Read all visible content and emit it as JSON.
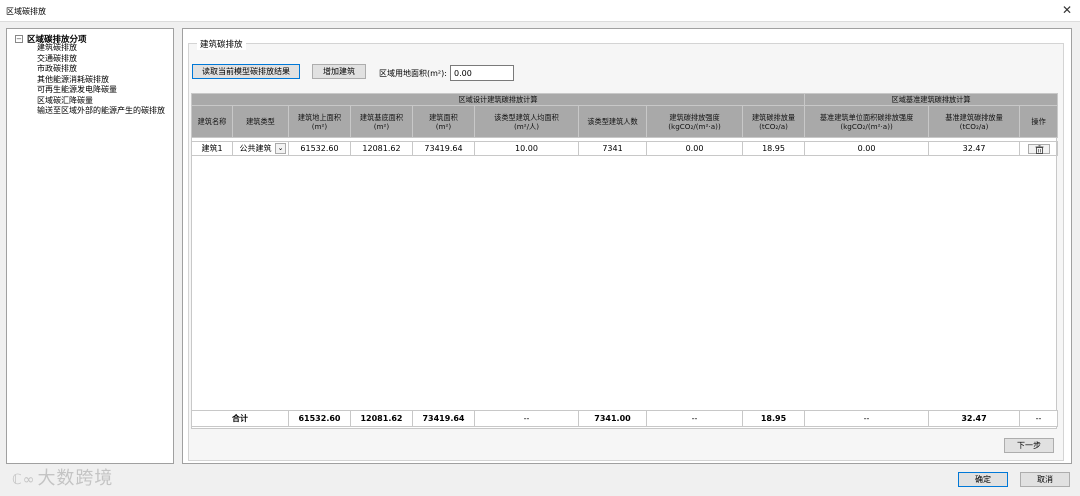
{
  "window": {
    "title": "区域碳排放",
    "close_glyph": "✕"
  },
  "tree": {
    "expander": "−",
    "root": "区域碳排放分项",
    "items": [
      "建筑碳排放",
      "交通碳排放",
      "市政碳排放",
      "其他能源消耗碳排放",
      "可再生能源发电降碳量",
      "区域碳汇降碳量",
      "输送至区域外部的能源产生的碳排放"
    ]
  },
  "panel": {
    "title": "建筑碳排放",
    "read_button": "读取当前模型碳排放结果",
    "add_button": "增加建筑",
    "area_label": "区域用地面积(m²):",
    "area_value": "0.00"
  },
  "table": {
    "group_design": "区域设计建筑碳排放计算",
    "group_baseline": "区域基准建筑碳排放计算",
    "columns": [
      [
        "建筑名称",
        ""
      ],
      [
        "建筑类型",
        ""
      ],
      [
        "建筑地上面积",
        "(m²)"
      ],
      [
        "建筑基底面积",
        "(m²)"
      ],
      [
        "建筑面积",
        "(m²)"
      ],
      [
        "该类型建筑人均面积",
        "(m²/人)"
      ],
      [
        "该类型建筑人数",
        ""
      ],
      [
        "建筑碳排放强度",
        "(kgCO₂/(m²·a))"
      ],
      [
        "建筑碳排放量",
        "(tCO₂/a)"
      ],
      [
        "基准建筑单位面积碳排放强度",
        "(kgCO₂/(m²·a))"
      ],
      [
        "基准建筑碳排放量",
        "(tCO₂/a)"
      ],
      [
        "操作",
        ""
      ]
    ],
    "rows": [
      {
        "name": "建筑1",
        "type": "公共建筑",
        "above_area": "61532.60",
        "base_area": "12081.62",
        "floor_area": "73419.64",
        "per_capita": "10.00",
        "people": "7341",
        "intensity": "0.00",
        "emission": "18.95",
        "baseline_intensity": "0.00",
        "baseline_emission": "32.47"
      }
    ],
    "total": {
      "label": "合计",
      "above_area": "61532.60",
      "base_area": "12081.62",
      "floor_area": "73419.64",
      "per_capita": "--",
      "people": "7341.00",
      "intensity": "--",
      "emission": "18.95",
      "baseline_intensity": "--",
      "baseline_emission": "32.47",
      "op": "--"
    }
  },
  "buttons": {
    "next": "下一步",
    "ok": "确定",
    "cancel": "取消"
  },
  "watermark": {
    "logo": "ℂ∞",
    "text": "大数跨境"
  },
  "icons": {
    "dropdown": "chevron-down-icon",
    "delete": "trash-icon",
    "close": "close-icon"
  }
}
